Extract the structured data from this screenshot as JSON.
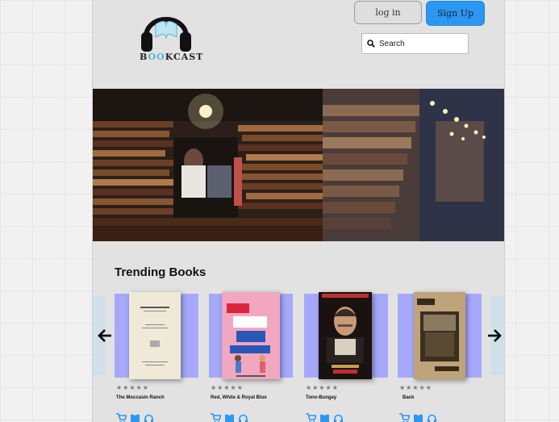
{
  "header": {
    "logo_text_before": "B",
    "logo_text_highlight": "OO",
    "logo_text_after": "KCAST",
    "login_label": "log in",
    "signup_label": "Sign Up",
    "search_placeholder": "Search"
  },
  "hero": {
    "left_image": "woman-reading-among-book-stacks",
    "right_image": "library-bookshelves-with-hanging-lights"
  },
  "trending": {
    "title": "Trending Books",
    "books": [
      {
        "title": "The Moccasin Ranch",
        "rating": 0,
        "cover_title": "THE MOCCASIN RANCH"
      },
      {
        "title": "Red, White & Royal Blue",
        "rating": 0,
        "cover_title": "RED WHITE & ROYAL BLUE",
        "cover_author": "CASEY McQUISTON"
      },
      {
        "title": "Tono-Bungay",
        "rating": 0,
        "cover_title": "TONO-BUNGAY"
      },
      {
        "title": "Back",
        "rating": 0,
        "cover_title": "Back",
        "cover_author": "by Henry Green"
      }
    ]
  },
  "colors": {
    "accent": "#2c97f0",
    "card_bg": "#a6a9fb",
    "action_icon": "#2c97f0",
    "logo_highlight": "#4fb6d8"
  },
  "icons": {
    "cart": "cart-icon",
    "book": "book-icon",
    "headphones": "headphones-icon"
  }
}
